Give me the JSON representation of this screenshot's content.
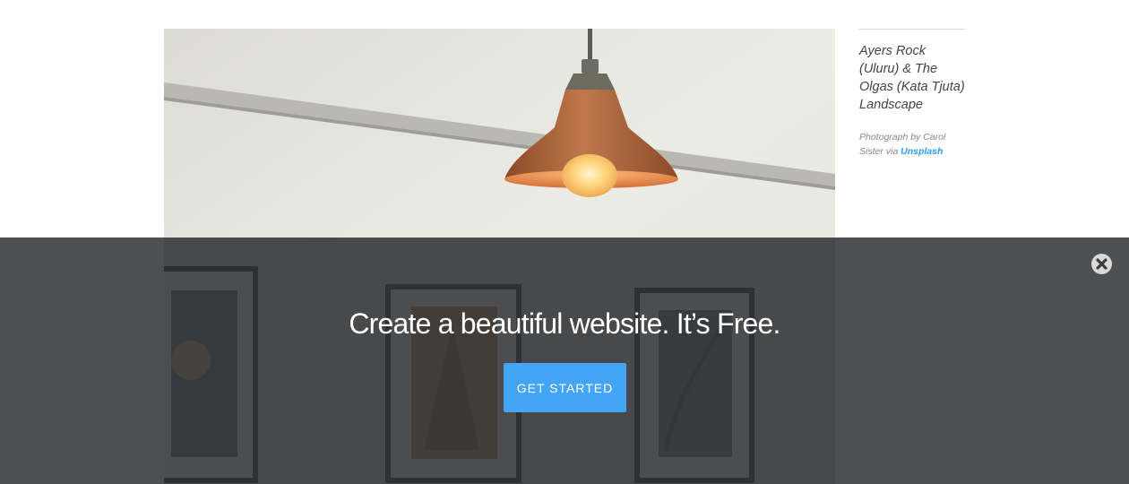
{
  "caption": {
    "title": "Ayers Rock (Uluru) & The Olgas (Kata Tjuta) Landscape",
    "credit_prefix": "Photograph by Carol Sister via ",
    "credit_link": "Unsplash"
  },
  "photo": {
    "subject": "copper pendant lamp and framed prints"
  },
  "overlay": {
    "headline": "Create a beautiful website. It’s Free.",
    "cta_label": "GET STARTED",
    "close_icon": "close-icon",
    "background_color": "#303235",
    "button_color": "#44a4f6"
  },
  "colors": {
    "link": "#2a9df4",
    "caption_text": "#444444",
    "credit_text": "#888888"
  }
}
